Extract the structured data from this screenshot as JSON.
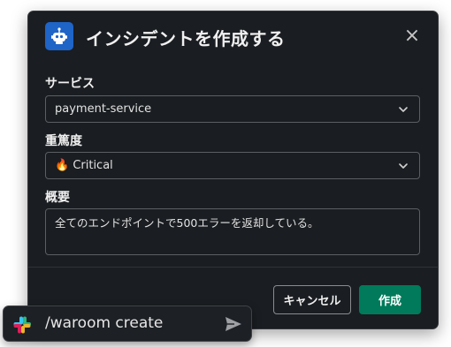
{
  "dialog": {
    "title": "インシデントを作成する",
    "app_icon": "robot-icon",
    "close_glyph": "×",
    "accent": "#1f64c7"
  },
  "fields": {
    "service": {
      "label": "サービス",
      "value": "payment-service"
    },
    "severity": {
      "label": "重篤度",
      "value": "🔥 Critical"
    },
    "summary": {
      "label": "概要",
      "value": "全てのエンドポイントで500エラーを返却している。"
    }
  },
  "actions": {
    "cancel_label": "キャンセル",
    "create_label": "作成",
    "create_color": "#007a5a"
  },
  "composer": {
    "command": "/waroom create",
    "logo": "slack-logo-icon",
    "send_icon": "send-icon"
  }
}
